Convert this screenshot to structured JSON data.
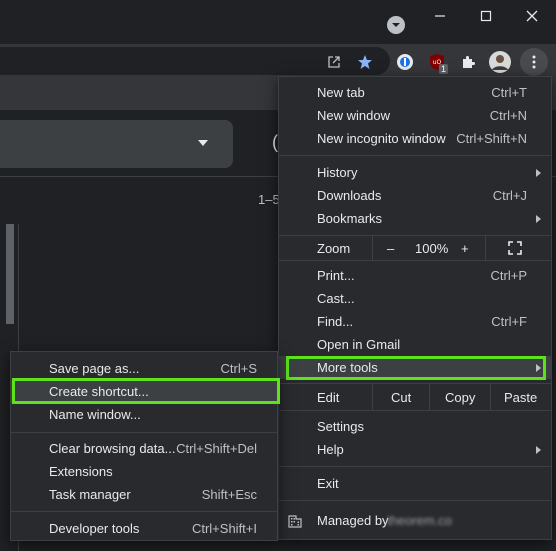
{
  "page": {
    "results_count": "1–5"
  },
  "main_menu": {
    "items": [
      {
        "label": "New tab",
        "shortcut": "Ctrl+T"
      },
      {
        "label": "New window",
        "shortcut": "Ctrl+N"
      },
      {
        "label": "New incognito window",
        "shortcut": "Ctrl+Shift+N"
      },
      {
        "label": "History"
      },
      {
        "label": "Downloads",
        "shortcut": "Ctrl+J"
      },
      {
        "label": "Bookmarks"
      },
      {
        "label": "Print...",
        "shortcut": "Ctrl+P"
      },
      {
        "label": "Cast..."
      },
      {
        "label": "Find...",
        "shortcut": "Ctrl+F"
      },
      {
        "label": "Open in Gmail"
      },
      {
        "label": "More tools"
      },
      {
        "label": "Settings"
      },
      {
        "label": "Help"
      },
      {
        "label": "Exit"
      }
    ],
    "zoom": {
      "label": "Zoom",
      "minus": "–",
      "value": "100%",
      "plus": "+"
    },
    "edit": {
      "label": "Edit",
      "cut": "Cut",
      "copy": "Copy",
      "paste": "Paste"
    },
    "managed": {
      "label": "Managed by",
      "domain": "theorem.co"
    }
  },
  "more_tools_menu": {
    "items": [
      {
        "label": "Save page as...",
        "shortcut": "Ctrl+S"
      },
      {
        "label": "Create shortcut..."
      },
      {
        "label": "Name window..."
      },
      {
        "label": "Clear browsing data...",
        "shortcut": "Ctrl+Shift+Del"
      },
      {
        "label": "Extensions"
      },
      {
        "label": "Task manager",
        "shortcut": "Shift+Esc"
      },
      {
        "label": "Developer tools",
        "shortcut": "Ctrl+Shift+I"
      }
    ]
  },
  "toolbar": {
    "ublock_badge": "1"
  },
  "colors": {
    "highlight": "#5ee31b",
    "menu_bg": "#292a2d",
    "chrome_bg": "#202124"
  }
}
